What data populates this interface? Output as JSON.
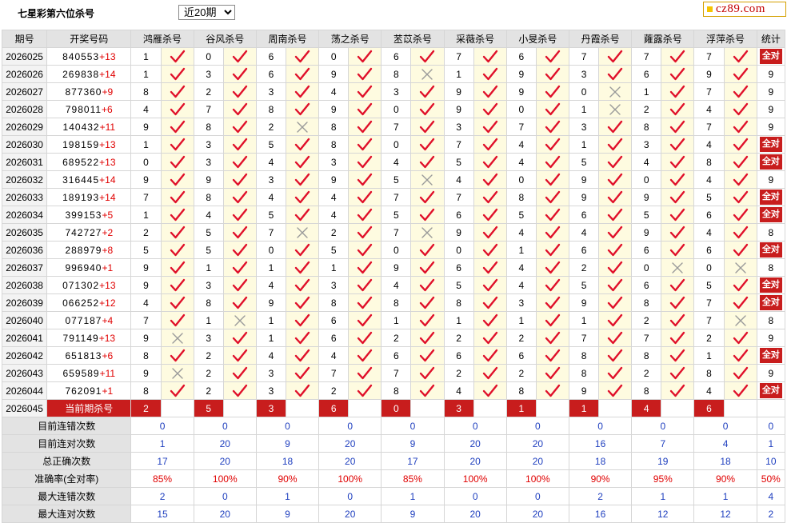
{
  "page": {
    "title": "七星彩第六位杀号",
    "select_value": "近20期",
    "logo_text": "cz89.com"
  },
  "headers": [
    "期号",
    "开奖号码",
    "鸿雁杀号",
    "谷风杀号",
    "周南杀号",
    "荡之杀号",
    "苤苡杀号",
    "采薇杀号",
    "小旻杀号",
    "丹霞杀号",
    "蕹露杀号",
    "浮萍杀号",
    "统计"
  ],
  "rows": [
    {
      "p": "2026025",
      "main": "840553",
      "bonus": "+13",
      "k": [
        "1",
        "0",
        "6",
        "0",
        "6",
        "7",
        "6",
        "7",
        "7",
        "7"
      ],
      "m": [
        1,
        1,
        1,
        1,
        1,
        1,
        1,
        1,
        1,
        1
      ],
      "stat": "全对"
    },
    {
      "p": "2026026",
      "main": "269838",
      "bonus": "+14",
      "k": [
        "1",
        "3",
        "6",
        "9",
        "8",
        "1",
        "9",
        "3",
        "6",
        "9"
      ],
      "m": [
        1,
        1,
        1,
        1,
        0,
        1,
        1,
        1,
        1,
        1
      ],
      "stat": "9"
    },
    {
      "p": "2026027",
      "main": "877360",
      "bonus": "+9",
      "k": [
        "8",
        "2",
        "3",
        "4",
        "3",
        "9",
        "9",
        "0",
        "1",
        "7"
      ],
      "m": [
        1,
        1,
        1,
        1,
        1,
        1,
        1,
        0,
        1,
        1
      ],
      "stat": "9"
    },
    {
      "p": "2026028",
      "main": "798011",
      "bonus": "+6",
      "k": [
        "4",
        "7",
        "8",
        "9",
        "0",
        "9",
        "0",
        "1",
        "2",
        "4"
      ],
      "m": [
        1,
        1,
        1,
        1,
        1,
        1,
        1,
        0,
        1,
        1
      ],
      "stat": "9"
    },
    {
      "p": "2026029",
      "main": "140432",
      "bonus": "+11",
      "k": [
        "9",
        "8",
        "2",
        "8",
        "7",
        "3",
        "7",
        "3",
        "8",
        "7"
      ],
      "m": [
        1,
        1,
        0,
        1,
        1,
        1,
        1,
        1,
        1,
        1
      ],
      "stat": "9"
    },
    {
      "p": "2026030",
      "main": "198159",
      "bonus": "+13",
      "k": [
        "1",
        "3",
        "5",
        "8",
        "0",
        "7",
        "4",
        "1",
        "3",
        "4"
      ],
      "m": [
        1,
        1,
        1,
        1,
        1,
        1,
        1,
        1,
        1,
        1
      ],
      "stat": "全对"
    },
    {
      "p": "2026031",
      "main": "689522",
      "bonus": "+13",
      "k": [
        "0",
        "3",
        "4",
        "3",
        "4",
        "5",
        "4",
        "5",
        "4",
        "8"
      ],
      "m": [
        1,
        1,
        1,
        1,
        1,
        1,
        1,
        1,
        1,
        1
      ],
      "stat": "全对"
    },
    {
      "p": "2026032",
      "main": "316445",
      "bonus": "+14",
      "k": [
        "9",
        "9",
        "3",
        "9",
        "5",
        "4",
        "0",
        "9",
        "0",
        "4"
      ],
      "m": [
        1,
        1,
        1,
        1,
        0,
        1,
        1,
        1,
        1,
        1
      ],
      "stat": "9"
    },
    {
      "p": "2026033",
      "main": "189193",
      "bonus": "+14",
      "k": [
        "7",
        "8",
        "4",
        "4",
        "7",
        "7",
        "8",
        "9",
        "9",
        "5"
      ],
      "m": [
        1,
        1,
        1,
        1,
        1,
        1,
        1,
        1,
        1,
        1
      ],
      "stat": "全对"
    },
    {
      "p": "2026034",
      "main": "399153",
      "bonus": "+5",
      "k": [
        "1",
        "4",
        "5",
        "4",
        "5",
        "6",
        "5",
        "6",
        "5",
        "6"
      ],
      "m": [
        1,
        1,
        1,
        1,
        1,
        1,
        1,
        1,
        1,
        1
      ],
      "stat": "全对"
    },
    {
      "p": "2026035",
      "main": "742727",
      "bonus": "+2",
      "k": [
        "2",
        "5",
        "7",
        "2",
        "7",
        "9",
        "4",
        "4",
        "9",
        "4"
      ],
      "m": [
        1,
        1,
        0,
        1,
        0,
        1,
        1,
        1,
        1,
        1
      ],
      "stat": "8"
    },
    {
      "p": "2026036",
      "main": "288979",
      "bonus": "+8",
      "k": [
        "5",
        "5",
        "0",
        "5",
        "0",
        "0",
        "1",
        "6",
        "6",
        "6"
      ],
      "m": [
        1,
        1,
        1,
        1,
        1,
        1,
        1,
        1,
        1,
        1
      ],
      "stat": "全对"
    },
    {
      "p": "2026037",
      "main": "996940",
      "bonus": "+1",
      "k": [
        "9",
        "1",
        "1",
        "1",
        "9",
        "6",
        "4",
        "2",
        "0",
        "0"
      ],
      "m": [
        1,
        1,
        1,
        1,
        1,
        1,
        1,
        1,
        0,
        0
      ],
      "stat": "8"
    },
    {
      "p": "2026038",
      "main": "071302",
      "bonus": "+13",
      "k": [
        "9",
        "3",
        "4",
        "3",
        "4",
        "5",
        "4",
        "5",
        "6",
        "5"
      ],
      "m": [
        1,
        1,
        1,
        1,
        1,
        1,
        1,
        1,
        1,
        1
      ],
      "stat": "全对"
    },
    {
      "p": "2026039",
      "main": "066252",
      "bonus": "+12",
      "k": [
        "4",
        "8",
        "9",
        "8",
        "8",
        "8",
        "3",
        "9",
        "8",
        "7"
      ],
      "m": [
        1,
        1,
        1,
        1,
        1,
        1,
        1,
        1,
        1,
        1
      ],
      "stat": "全对"
    },
    {
      "p": "2026040",
      "main": "077187",
      "bonus": "+4",
      "k": [
        "7",
        "1",
        "1",
        "6",
        "1",
        "1",
        "1",
        "1",
        "2",
        "7"
      ],
      "m": [
        1,
        0,
        1,
        1,
        1,
        1,
        1,
        1,
        1,
        0
      ],
      "stat": "8"
    },
    {
      "p": "2026041",
      "main": "791149",
      "bonus": "+13",
      "k": [
        "9",
        "3",
        "1",
        "6",
        "2",
        "2",
        "2",
        "7",
        "7",
        "2"
      ],
      "m": [
        0,
        1,
        1,
        1,
        1,
        1,
        1,
        1,
        1,
        1
      ],
      "stat": "9"
    },
    {
      "p": "2026042",
      "main": "651813",
      "bonus": "+6",
      "k": [
        "8",
        "2",
        "4",
        "4",
        "6",
        "6",
        "6",
        "8",
        "8",
        "1"
      ],
      "m": [
        1,
        1,
        1,
        1,
        1,
        1,
        1,
        1,
        1,
        1
      ],
      "stat": "全对"
    },
    {
      "p": "2026043",
      "main": "659589",
      "bonus": "+11",
      "k": [
        "9",
        "2",
        "3",
        "7",
        "7",
        "2",
        "2",
        "8",
        "2",
        "8"
      ],
      "m": [
        0,
        1,
        1,
        1,
        1,
        1,
        1,
        1,
        1,
        1
      ],
      "stat": "9"
    },
    {
      "p": "2026044",
      "main": "762091",
      "bonus": "+1",
      "k": [
        "8",
        "2",
        "3",
        "2",
        "8",
        "4",
        "8",
        "9",
        "8",
        "4"
      ],
      "m": [
        1,
        1,
        1,
        1,
        1,
        1,
        1,
        1,
        1,
        1
      ],
      "stat": "全对"
    }
  ],
  "current": {
    "p": "2026045",
    "label": "当前期杀号",
    "k": [
      "2",
      "5",
      "3",
      "6",
      "0",
      "3",
      "1",
      "1",
      "4",
      "6"
    ]
  },
  "stats": [
    {
      "label": "目前连错次数",
      "v": [
        "0",
        "0",
        "0",
        "0",
        "0",
        "0",
        "0",
        "0",
        "0",
        "0"
      ],
      "total": "0",
      "red": false
    },
    {
      "label": "目前连对次数",
      "v": [
        "1",
        "20",
        "9",
        "20",
        "9",
        "20",
        "20",
        "16",
        "7",
        "4"
      ],
      "total": "1",
      "red": false
    },
    {
      "label": "总正确次数",
      "v": [
        "17",
        "20",
        "18",
        "20",
        "17",
        "20",
        "20",
        "18",
        "19",
        "18"
      ],
      "total": "10",
      "red": false
    },
    {
      "label": "准确率(全对率)",
      "v": [
        "85%",
        "100%",
        "90%",
        "100%",
        "85%",
        "100%",
        "100%",
        "90%",
        "95%",
        "90%"
      ],
      "total": "50%",
      "red": true
    },
    {
      "label": "最大连错次数",
      "v": [
        "2",
        "0",
        "1",
        "0",
        "1",
        "0",
        "0",
        "2",
        "1",
        "1"
      ],
      "total": "4",
      "red": false
    },
    {
      "label": "最大连对次数",
      "v": [
        "15",
        "20",
        "9",
        "20",
        "9",
        "20",
        "20",
        "16",
        "12",
        "12"
      ],
      "total": "2",
      "red": false
    }
  ],
  "colors": {
    "accent_red": "#c81d1d",
    "check_red": "#e0102a",
    "cross_gray": "#9a9a9a",
    "stat_blue": "#1f3fbf"
  },
  "icons": {
    "correct": "check-mark-icon",
    "wrong": "cross-mark-icon"
  }
}
